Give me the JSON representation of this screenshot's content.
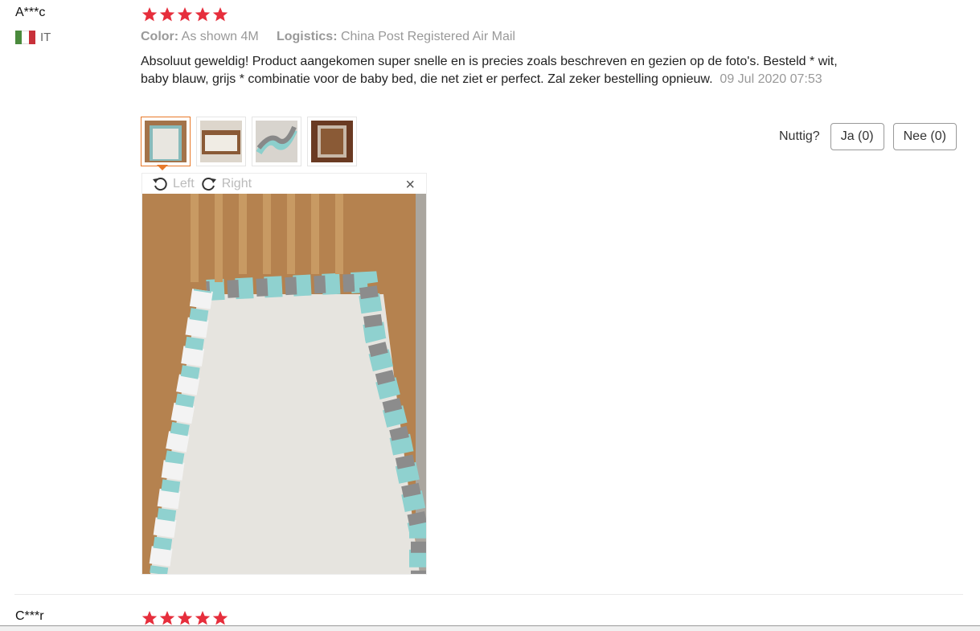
{
  "review": {
    "user": "A***c",
    "country_code": "IT",
    "flag_colors": [
      "#4a8a3c",
      "#ffffff",
      "#c8313a"
    ],
    "rating_stars": 5,
    "color_label": "Color:",
    "color_value": "As shown 4M",
    "logistics_label": "Logistics:",
    "logistics_value": "China Post Registered Air Mail",
    "text": "Absoluut geweldig! Product aangekomen super snelle en is precies zoals beschreven en gezien op de foto's. Besteld * wit, baby blauw, grijs * combinatie voor de baby bed, die net ziet er perfect. Zal zeker bestelling opnieuw.",
    "date": "09 Jul 2020 07:53",
    "thumbnails": [
      "photo-crib-top-view",
      "photo-crib-wide",
      "photo-braid-closeup",
      "photo-crib-dark"
    ],
    "helpful": {
      "label": "Nuttig?",
      "yes": "Ja (0)",
      "no": "Nee (0)"
    },
    "viewer": {
      "left": "Left",
      "right": "Right",
      "close": "×"
    }
  },
  "next_review": {
    "user": "C***r",
    "rating_stars": 5
  },
  "colors": {
    "star": "#e62e3c",
    "accent": "#e8792a"
  }
}
